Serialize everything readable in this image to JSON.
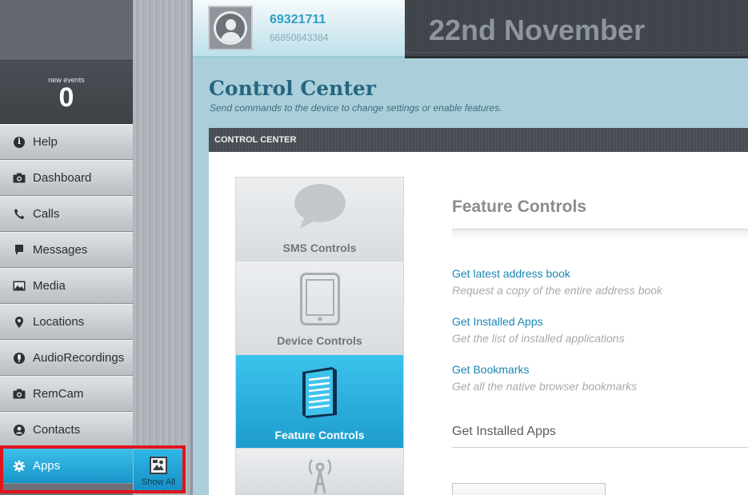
{
  "sidebar": {
    "events_label": "new events",
    "events_count": "0",
    "items": [
      {
        "label": "Help"
      },
      {
        "label": "Dashboard"
      },
      {
        "label": "Calls"
      },
      {
        "label": "Messages"
      },
      {
        "label": "Media"
      },
      {
        "label": "Locations"
      },
      {
        "label": "AudioRecordings"
      },
      {
        "label": "RemCam"
      },
      {
        "label": "Contacts"
      },
      {
        "label": "Apps"
      }
    ],
    "show_all_label": "Show All"
  },
  "header": {
    "device_name": "69321711",
    "device_number": "66850643384",
    "date": "22nd November"
  },
  "main": {
    "title": "Control Center",
    "subtitle": "Send commands to the device to change settings or enable features.",
    "panel_title": "CONTROL CENTER",
    "tabs": [
      {
        "label": "SMS Controls"
      },
      {
        "label": "Device Controls"
      },
      {
        "label": "Feature Controls"
      }
    ],
    "feature_title": "Feature Controls",
    "features": [
      {
        "link": "Get latest address book",
        "desc": "Request a copy of the entire address book"
      },
      {
        "link": "Get Installed Apps",
        "desc": "Get the list of installed applications"
      },
      {
        "link": "Get Bookmarks",
        "desc": "Get all the native browser bookmarks"
      }
    ],
    "section_title": "Get Installed Apps"
  },
  "colors": {
    "accent": "#1ea0d2",
    "highlight": "#e0141b"
  }
}
